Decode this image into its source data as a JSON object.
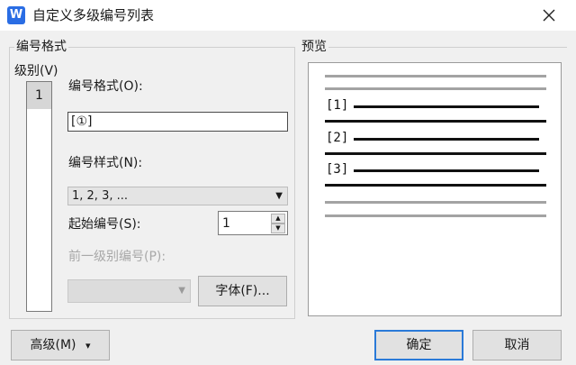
{
  "window": {
    "title": "自定义多级编号列表",
    "app_icon": "W"
  },
  "format_group": {
    "title": "编号格式",
    "level_label": "级别(V)",
    "levels": [
      "1"
    ],
    "number_format_label": "编号格式(O):",
    "number_format_value": "[①]",
    "number_style_label": "编号样式(N):",
    "number_style_value": "1, 2, 3, ...",
    "start_at_label": "起始编号(S):",
    "start_at_value": "1",
    "prev_level_label": "前一级别编号(P):",
    "prev_level_value": "",
    "font_button": "字体(F)..."
  },
  "preview_group": {
    "title": "预览",
    "items": [
      "[1]",
      "[2]",
      "[3]"
    ]
  },
  "footer": {
    "advanced_button": "高级(M)",
    "advanced_arrow": "▾",
    "ok_button": "确定",
    "cancel_button": "取消"
  },
  "colors": {
    "accent": "#2a7ad8",
    "app_icon_bg": "#2a6de4"
  }
}
